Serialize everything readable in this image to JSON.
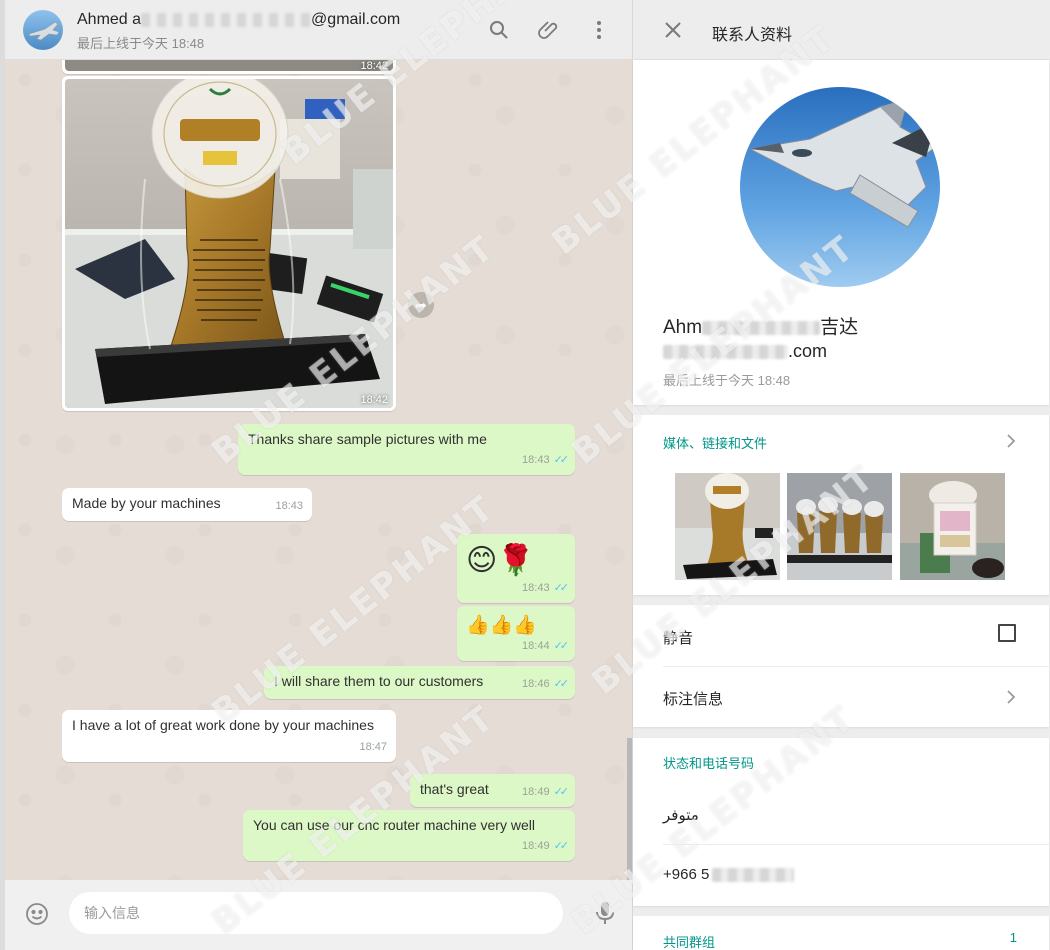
{
  "chat_header": {
    "name_prefix": "Ahmed a",
    "name_suffix": "@gmail.com",
    "last_seen": "最后上线于今天 18:48"
  },
  "messages": {
    "img1_time": "18:42",
    "img2_time": "18:42",
    "m1": {
      "text": "Thanks share sample pictures with me",
      "time": "18:43"
    },
    "m2": {
      "text": "Made by your machines",
      "time": "18:43"
    },
    "m3": {
      "emoji": "😊🌹",
      "time": "18:43"
    },
    "m4": {
      "emoji": "👍👍👍",
      "time": "18:44"
    },
    "m5": {
      "text": "I will share them to our customers",
      "time": "18:46"
    },
    "m6": {
      "text": "I have a lot of great work done by your machines",
      "time": "18:47"
    },
    "m7": {
      "text": "that's great",
      "time": "18:49"
    },
    "m8": {
      "text": "You can use our cnc router machine very well",
      "time": "18:49"
    }
  },
  "composer": {
    "placeholder": "输入信息"
  },
  "info_panel": {
    "title": "联系人资料",
    "name_start": "Ahm",
    "name_end": "吉达",
    "email_end": ".com",
    "last_seen": "最后上线于今天 18:48",
    "media_label": "媒体、链接和文件",
    "mute_label": "静音",
    "notes_label": "标注信息",
    "about_label": "状态和电话号码",
    "about_value": "متوفر",
    "phone_prefix": "+966 5",
    "groups_label": "共同群组",
    "groups_count": "1"
  },
  "watermark_text": "BLUE ELEPHANT",
  "colors": {
    "outgoing_bubble": "#dcf8c6",
    "incoming_bubble": "#ffffff",
    "chat_bg": "#e5ddd5",
    "accent": "#009688",
    "read_ticks": "#4fc3f7"
  },
  "icons": [
    "search-icon",
    "attach-icon",
    "menu-icon",
    "close-icon",
    "emoji-icon",
    "mic-icon",
    "forward-icon",
    "chevron-right-icon",
    "checkbox-icon"
  ]
}
